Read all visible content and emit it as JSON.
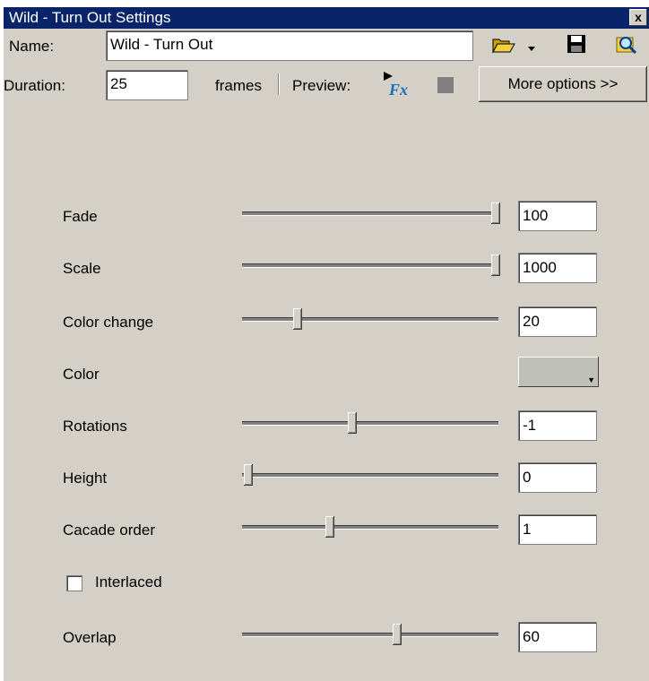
{
  "window": {
    "title": "Wild - Turn Out Settings",
    "close_glyph": "x"
  },
  "name": {
    "label": "Name:",
    "value": "Wild - Turn Out"
  },
  "duration": {
    "label": "Duration:",
    "value": "25",
    "unit": "frames"
  },
  "preview": {
    "label": "Preview:"
  },
  "toolbar": {
    "open_icon": "folder-open-icon",
    "dropdown_icon": "chevron-down-icon",
    "save_icon": "floppy-disk-icon",
    "browse_icon": "magnifier-icon",
    "play_fx_icon": "fx-play-icon",
    "stop_icon": "stop-icon",
    "more_options_label": "More options >>"
  },
  "params": [
    {
      "label": "Fade",
      "value": "100",
      "position": 1.0
    },
    {
      "label": "Scale",
      "value": "1000",
      "position": 1.0
    },
    {
      "label": "Color change",
      "value": "20",
      "position": 0.2
    },
    {
      "label": "Color",
      "swatch": "#bfc1b9"
    },
    {
      "label": "Rotations",
      "value": "-1",
      "position": 0.42
    },
    {
      "label": "Height",
      "value": "0",
      "position": 0.0
    },
    {
      "label": "Cacade order",
      "value": "1",
      "position": 0.33
    },
    {
      "label": "Interlaced",
      "checked": false
    },
    {
      "label": "Overlap",
      "value": "60",
      "position": 0.6
    }
  ],
  "colors": {
    "title_bar": "#0a246a",
    "dialog": "#d4d0c8",
    "fx_icon": "#1b6fb8"
  }
}
